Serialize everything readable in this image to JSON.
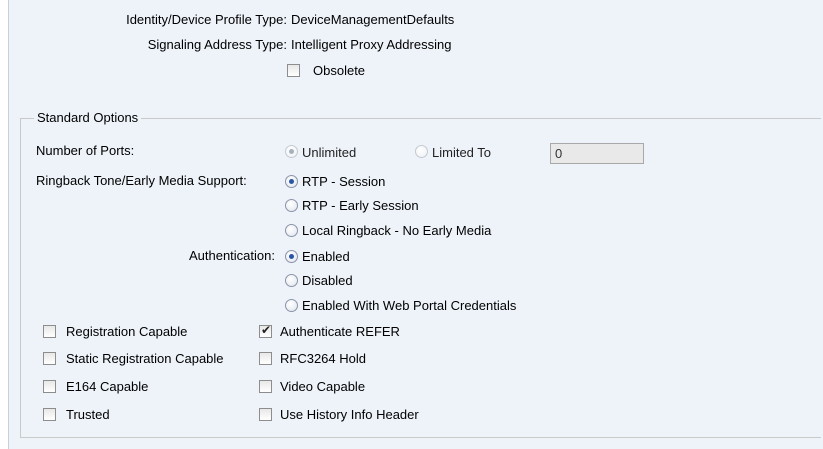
{
  "profile": {
    "identity_label": "Identity/Device Profile Type:",
    "identity_value": "DeviceManagementDefaults",
    "signaling_label": "Signaling Address Type:",
    "signaling_value": "Intelligent Proxy Addressing",
    "obsolete_label": "Obsolete",
    "obsolete_checked": false
  },
  "standard_options": {
    "legend": "Standard Options",
    "ports": {
      "label": "Number of Ports:",
      "options": [
        "Unlimited",
        "Limited To"
      ],
      "selected": "Unlimited",
      "disabled": true,
      "limit_value": "0"
    },
    "ringback": {
      "label": "Ringback Tone/Early Media Support:",
      "options": [
        "RTP - Session",
        "RTP - Early Session",
        "Local Ringback - No Early Media"
      ],
      "selected": "RTP - Session"
    },
    "authentication": {
      "label": "Authentication:",
      "options": [
        "Enabled",
        "Disabled",
        "Enabled With Web Portal Credentials"
      ],
      "selected": "Enabled"
    },
    "checkboxes_left": [
      {
        "label": "Registration Capable",
        "checked": false
      },
      {
        "label": "Static Registration Capable",
        "checked": false
      },
      {
        "label": "E164 Capable",
        "checked": false
      },
      {
        "label": "Trusted",
        "checked": false
      }
    ],
    "checkboxes_right": [
      {
        "label": "Authenticate REFER",
        "checked": true
      },
      {
        "label": "RFC3264 Hold",
        "checked": false
      },
      {
        "label": "Video Capable",
        "checked": false
      },
      {
        "label": "Use History Info Header",
        "checked": false
      }
    ]
  }
}
